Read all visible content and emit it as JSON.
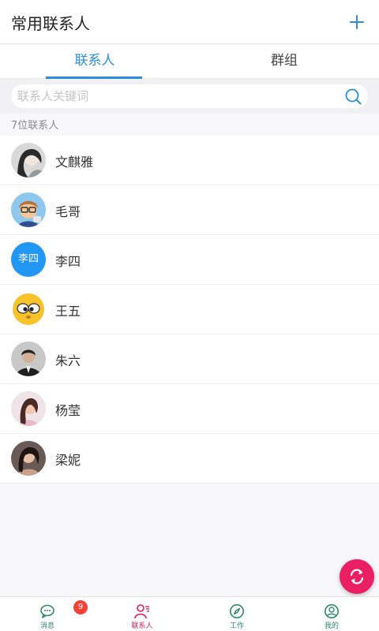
{
  "header": {
    "title": "常用联系人",
    "add_icon": "plus-icon"
  },
  "tabs": [
    {
      "label": "联系人",
      "active": true
    },
    {
      "label": "群组",
      "active": false
    }
  ],
  "search": {
    "placeholder": "联系人关键词",
    "value": "",
    "icon": "search-icon"
  },
  "contact_count": "7位联系人",
  "contacts": [
    {
      "name": "文麒雅",
      "avatar": "photo-woman-avatar"
    },
    {
      "name": "毛哥",
      "avatar": "cartoon-man-avatar"
    },
    {
      "name": "李四",
      "avatar_text": "李四",
      "avatar_color": "#2196f3"
    },
    {
      "name": "王五",
      "avatar": "emoji-face-avatar"
    },
    {
      "name": "朱六",
      "avatar": "photo-man-avatar"
    },
    {
      "name": "杨莹",
      "avatar": "photo-woman-avatar"
    },
    {
      "name": "梁妮",
      "avatar": "photo-woman-avatar"
    }
  ],
  "fab": {
    "icon": "refresh-icon",
    "color": "#e91e63"
  },
  "bottom_nav": [
    {
      "label": "消息",
      "icon": "chat-icon",
      "badge": "9"
    },
    {
      "label": "联系人",
      "icon": "contacts-icon",
      "active": true
    },
    {
      "label": "工作",
      "icon": "compass-icon"
    },
    {
      "label": "我的",
      "icon": "profile-icon"
    }
  ],
  "colors": {
    "accent": "#2a8fd6",
    "active_nav": "#d81b60",
    "nav": "#2d8a66",
    "badge": "#f44336"
  }
}
